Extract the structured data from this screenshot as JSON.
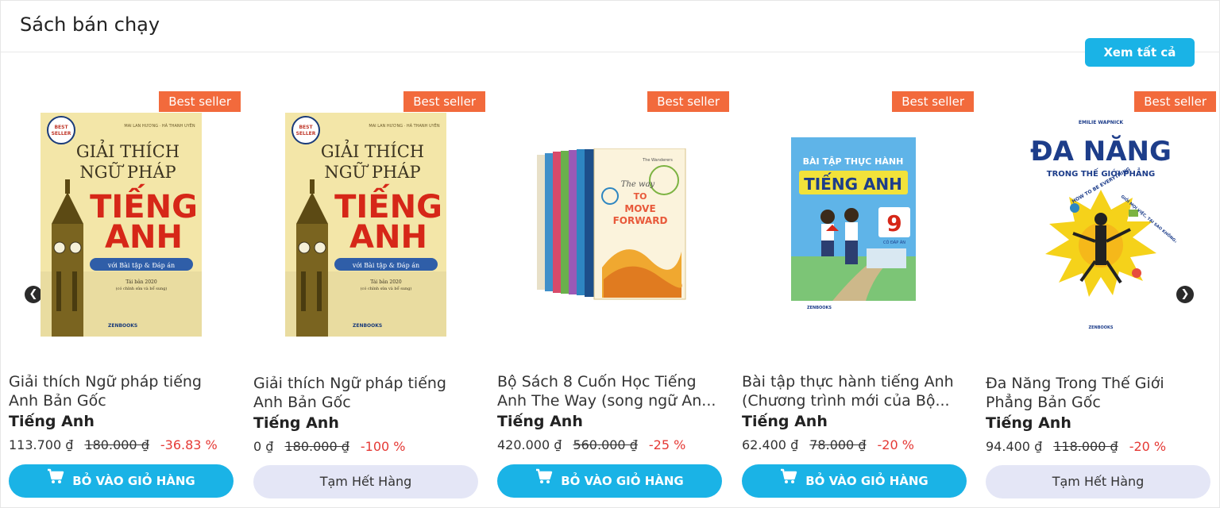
{
  "section": {
    "title": "Sách bán chạy",
    "view_all": "Xem tất cả"
  },
  "colors": {
    "accent": "#1ab3e6",
    "badge": "#f26a3c",
    "discount": "#e53935",
    "out_of_stock_bg": "#e4e6f6"
  },
  "products": [
    {
      "badge": "Best seller",
      "title": "Giải thích Ngữ pháp tiếng Anh Bản Gốc",
      "category": "Tiếng Anh",
      "price": "113.700 ₫",
      "old_price": "180.000 ₫",
      "discount": "-36.83 %",
      "action": "BỎ VÀO GIỎ HÀNG",
      "cover": {
        "authors": "MAI LAN HƯƠNG · HÀ THANH UYÊN",
        "line1": "GIẢI THÍCH",
        "line2": "NGỮ PHÁP",
        "line3": "TIẾNG",
        "line4": "ANH",
        "sub": "với Bài tập & Đáp án",
        "edition": "Tái bản 2020",
        "note": "(có chỉnh sửa và bổ sung)",
        "seal_top": "BEST",
        "seal_bottom": "SELLER",
        "publisher": "ZENBOOKS"
      }
    },
    {
      "badge": "Best seller",
      "title": "Giải thích Ngữ pháp tiếng Anh Bản Gốc",
      "category": "Tiếng Anh",
      "price": "0 ₫",
      "old_price": "180.000 ₫",
      "discount": "-100 %",
      "action": "Tạm Hết Hàng",
      "cover": {
        "authors": "MAI LAN HƯƠNG · HÀ THANH UYÊN",
        "line1": "GIẢI THÍCH",
        "line2": "NGỮ PHÁP",
        "line3": "TIẾNG",
        "line4": "ANH",
        "sub": "với Bài tập & Đáp án",
        "edition": "Tái bản 2020",
        "note": "(có chỉnh sửa và bổ sung)",
        "seal_top": "BEST",
        "seal_bottom": "SELLER",
        "publisher": "ZENBOOKS"
      }
    },
    {
      "badge": "Best seller",
      "title": "Bộ Sách 8 Cuốn Học Tiếng Anh The Way (song ngữ An...",
      "category": "Tiếng Anh",
      "price": "420.000 ₫",
      "old_price": "560.000 ₫",
      "discount": "-25 %",
      "action": "BỎ VÀO GIỎ HÀNG",
      "cover": {
        "line1": "The way",
        "line2": "TO",
        "line3": "MOVE",
        "line4": "FORWARD",
        "series": "The Wanderers"
      }
    },
    {
      "badge": "Best seller",
      "title": "Bài tập thực hành tiếng Anh (Chương trình mới của Bộ...",
      "category": "Tiếng Anh",
      "price": "62.400 ₫",
      "old_price": "78.000 ₫",
      "discount": "-20 %",
      "action": "BỎ VÀO GIỎ HÀNG",
      "cover": {
        "line1": "BÀI TẬP THỰC HÀNH",
        "line2": "TIẾNG ANH",
        "grade": "9",
        "grade_note": "CÓ ĐÁP ÁN",
        "publisher": "ZENBOOKS"
      }
    },
    {
      "badge": "Best seller",
      "title": "Đa Năng Trong Thế Giới Phẳng Bản Gốc",
      "category": "Tiếng Anh",
      "price": "94.400 ₫",
      "old_price": "118.000 ₫",
      "discount": "-20 %",
      "action": "Tạm Hết Hàng",
      "cover": {
        "author": "EMILIE WAPNICK",
        "line1": "ĐA NĂNG",
        "line2": "TRONG THẾ GIỚI PHẲNG",
        "arc1": "HOW TO BE EVERYTHING",
        "arc2": "GIỎI MỌI VIỆC, TẠI SAO KHÔNG?",
        "publisher": "ZENBOOKS"
      }
    }
  ]
}
